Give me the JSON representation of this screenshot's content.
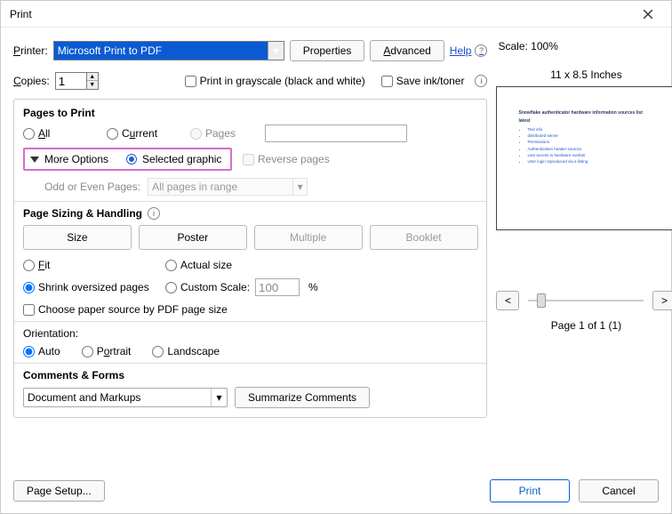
{
  "titlebar": {
    "title": "Print"
  },
  "toolbar": {
    "printer_label": "Printer:",
    "printer_value": "Microsoft Print to PDF",
    "properties": "Properties",
    "advanced": "Advanced",
    "help": "Help",
    "copies_label": "Copies:",
    "copies_value": "1",
    "grayscale": "Print in grayscale (black and white)",
    "save_ink": "Save ink/toner"
  },
  "pages": {
    "title": "Pages to Print",
    "all": "All",
    "current": "Current",
    "pages": "Pages",
    "more_options": "More Options",
    "selected_graphic": "Selected graphic",
    "reverse": "Reverse pages",
    "odd_even_label": "Odd or Even Pages:",
    "odd_even_value": "All pages in range"
  },
  "sizing": {
    "title": "Page Sizing & Handling",
    "size": "Size",
    "poster": "Poster",
    "multiple": "Multiple",
    "booklet": "Booklet",
    "fit": "Fit",
    "actual": "Actual size",
    "shrink": "Shrink oversized pages",
    "custom": "Custom Scale:",
    "custom_value": "100",
    "percent": "%",
    "choose_paper": "Choose paper source by PDF page size"
  },
  "orientation": {
    "title": "Orientation:",
    "auto": "Auto",
    "portrait": "Portrait",
    "landscape": "Landscape"
  },
  "comments": {
    "title": "Comments & Forms",
    "dropdown": "Document and Markups",
    "summarize": "Summarize Comments"
  },
  "preview": {
    "scale": "Scale: 100%",
    "paper": "11 x 8.5 Inches",
    "page_info": "Page 1 of 1 (1)",
    "nav_prev": "<",
    "nav_next": ">"
  },
  "footer": {
    "page_setup": "Page Setup...",
    "print": "Print",
    "cancel": "Cancel"
  }
}
